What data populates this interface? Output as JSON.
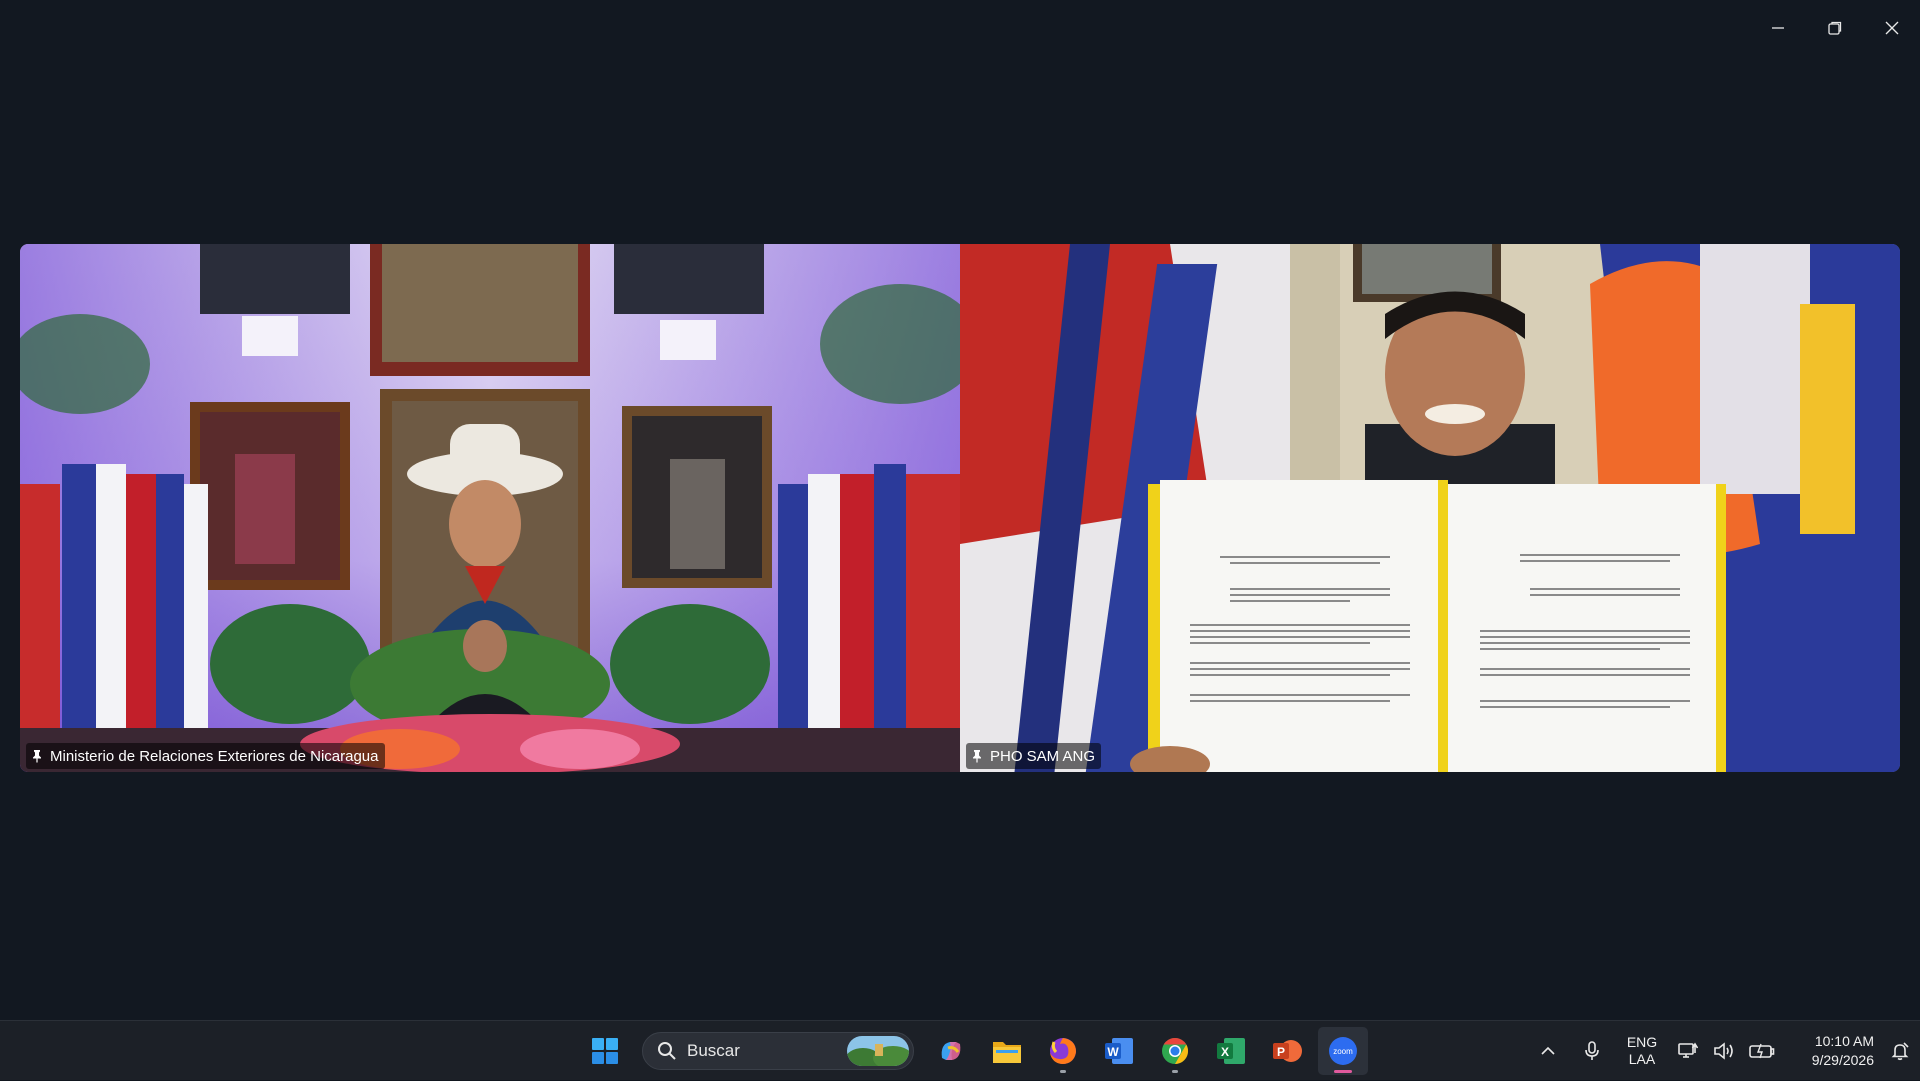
{
  "window": {
    "controls": {
      "minimize": "minimize-icon",
      "restore": "restore-icon",
      "close": "close-icon"
    }
  },
  "participants": [
    {
      "name": "Ministerio de Relaciones Exteriores de Nicaragua",
      "pinned": true
    },
    {
      "name": "PHO SAM ANG",
      "pinned": true
    }
  ],
  "taskbar": {
    "search_placeholder": "Buscar",
    "apps": [
      "start-icon",
      "copilot-icon",
      "file-explorer-icon",
      "firefox-icon",
      "word-icon",
      "chrome-icon",
      "excel-icon",
      "powerpoint-icon",
      "zoom-icon"
    ],
    "active_app": "zoom-icon",
    "tray": {
      "lang_line1": "ENG",
      "lang_line2": "LAA",
      "time": "10:10 AM",
      "date": "9/29/2026"
    }
  },
  "colors": {
    "window_bg": "#121821",
    "taskbar_bg": "#1c2027",
    "zoom_blue": "#2d6cf0",
    "active_indicator": "#e05a9d"
  }
}
